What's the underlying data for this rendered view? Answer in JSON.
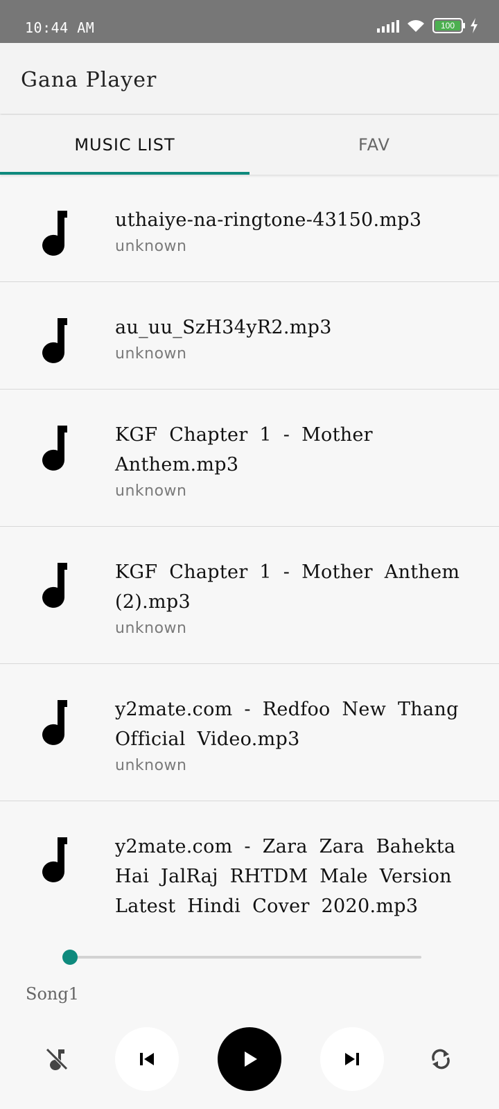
{
  "status_bar": {
    "time": "10:44 AM",
    "battery": "100"
  },
  "app_bar": {
    "title": "Gana Player"
  },
  "tabs": [
    {
      "label": "MUSIC LIST",
      "active": true
    },
    {
      "label": "FAV",
      "active": false
    }
  ],
  "songs": [
    {
      "title": "uthaiye-na-ringtone-43150.mp3",
      "artist": "unknown"
    },
    {
      "title": "au_uu_SzH34yR2.mp3",
      "artist": "unknown"
    },
    {
      "title": "KGF Chapter 1 - Mother Anthem.mp3",
      "artist": "unknown"
    },
    {
      "title": "KGF Chapter 1 - Mother Anthem (2).mp3",
      "artist": "unknown"
    },
    {
      "title": "y2mate.com - Redfoo  New Thang Official Video.mp3",
      "artist": "unknown"
    },
    {
      "title": "y2mate.com - Zara Zara Bahekta Hai JalRaj RHTDM Male Version Latest Hindi Cover 2020.mp3",
      "artist": "unknown"
    }
  ],
  "player": {
    "now_playing": "Song1",
    "progress": 0,
    "accent_color": "#0e8a7d"
  },
  "icons": {
    "list_item": "music-note-icon",
    "shuffle": "music-off-icon",
    "previous": "skip-previous-icon",
    "play": "play-icon",
    "next": "skip-next-icon",
    "repeat": "repeat-icon"
  }
}
